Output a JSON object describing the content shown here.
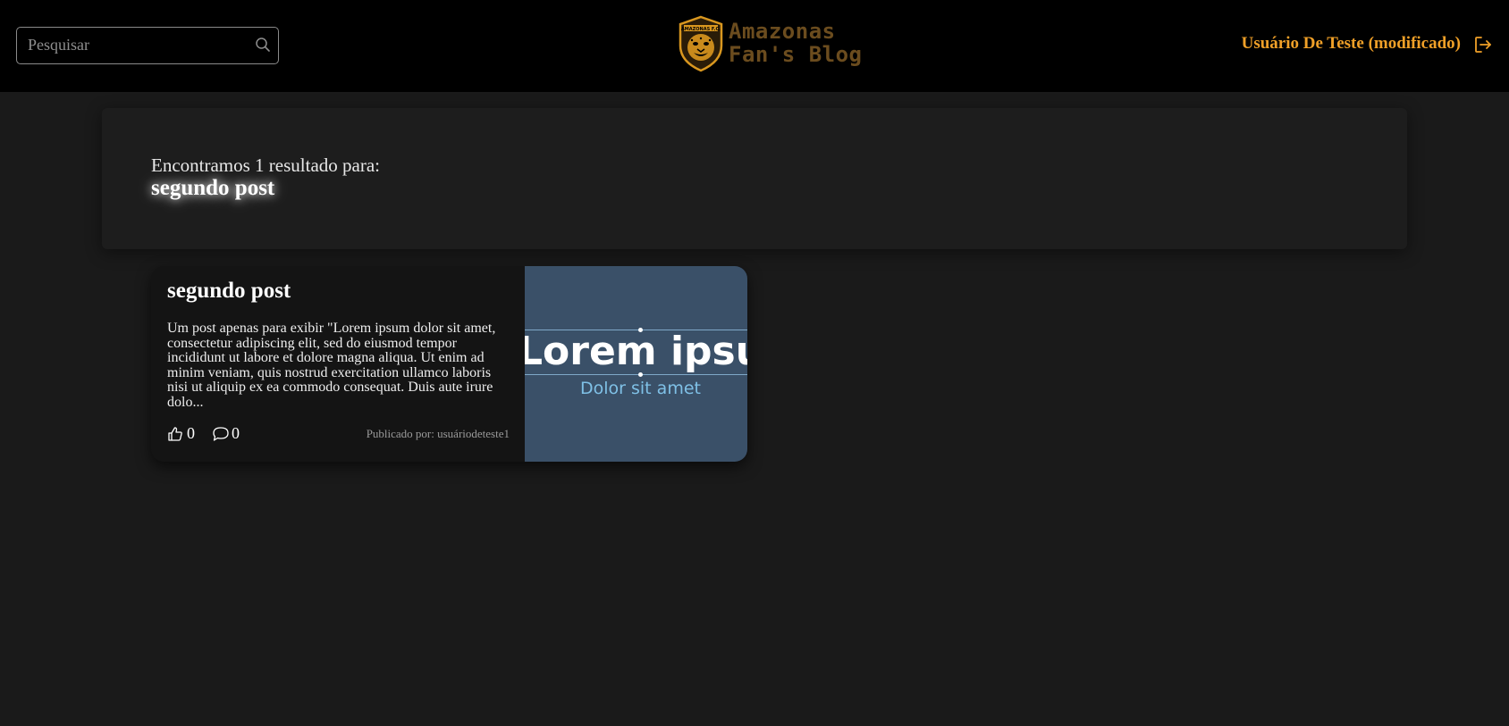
{
  "header": {
    "search": {
      "placeholder": "Pesquisar",
      "value": ""
    },
    "logo": {
      "line1": "Amazonas",
      "line2": "Fan's Blog",
      "badge_text": "AMAZONAS F.C."
    },
    "user_name": "Usuário De Teste (modificado)",
    "colors": {
      "accent": "#f0a028",
      "background": "#000000"
    }
  },
  "results": {
    "label": "Encontramos 1 resultado para:",
    "query": "segundo post"
  },
  "posts": [
    {
      "title": "segundo post",
      "excerpt": "Um post apenas para exibir \"Lorem ipsum dolor sit amet, consectetur adipiscing elit, sed do eiusmod tempor incididunt ut labore et dolore magna aliqua. Ut enim ad minim veniam, quis nostrud exercitation ullamco laboris nisi ut aliquip ex ea commodo consequat. Duis aute irure dolo...",
      "likes": "0",
      "comments": "0",
      "author": "Publicado por: usuáriodeteste1",
      "image": {
        "main_text": "Lorem ipsum",
        "sub_text": "Dolor sit amet",
        "background": "#3a5068"
      }
    }
  ]
}
